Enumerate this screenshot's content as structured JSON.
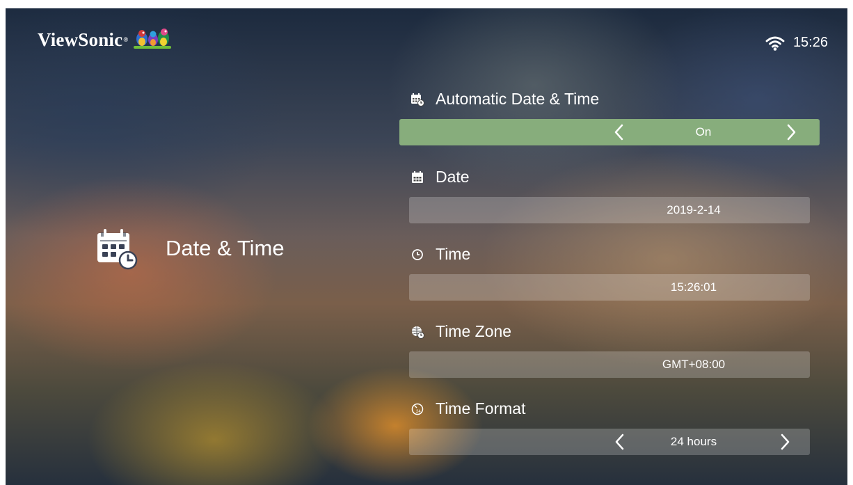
{
  "brand": {
    "name": "ViewSonic",
    "reg": "®"
  },
  "status": {
    "time": "15:26",
    "wifi_icon": "wifi-icon"
  },
  "page": {
    "title": "Date & Time",
    "icon": "calendar-clock-icon"
  },
  "settings": [
    {
      "label": "Automatic Date & Time",
      "icon": "calendar-sync-icon",
      "value": "On",
      "selected": true,
      "has_arrows": true
    },
    {
      "label": "Date",
      "icon": "calendar-icon",
      "value": "2019-2-14",
      "selected": false,
      "has_arrows": false
    },
    {
      "label": "Time",
      "icon": "clock-icon",
      "value": "15:26:01",
      "selected": false,
      "has_arrows": false
    },
    {
      "label": "Time Zone",
      "icon": "globe-clock-icon",
      "value": "GMT+08:00",
      "selected": false,
      "has_arrows": false
    },
    {
      "label": "Time Format",
      "icon": "24h-clock-icon",
      "value": "24 hours",
      "selected": false,
      "has_arrows": true
    }
  ],
  "colors": {
    "selected": "#87ad7c",
    "bar": "rgba(255,255,255,0.22)",
    "text": "#ffffff"
  }
}
